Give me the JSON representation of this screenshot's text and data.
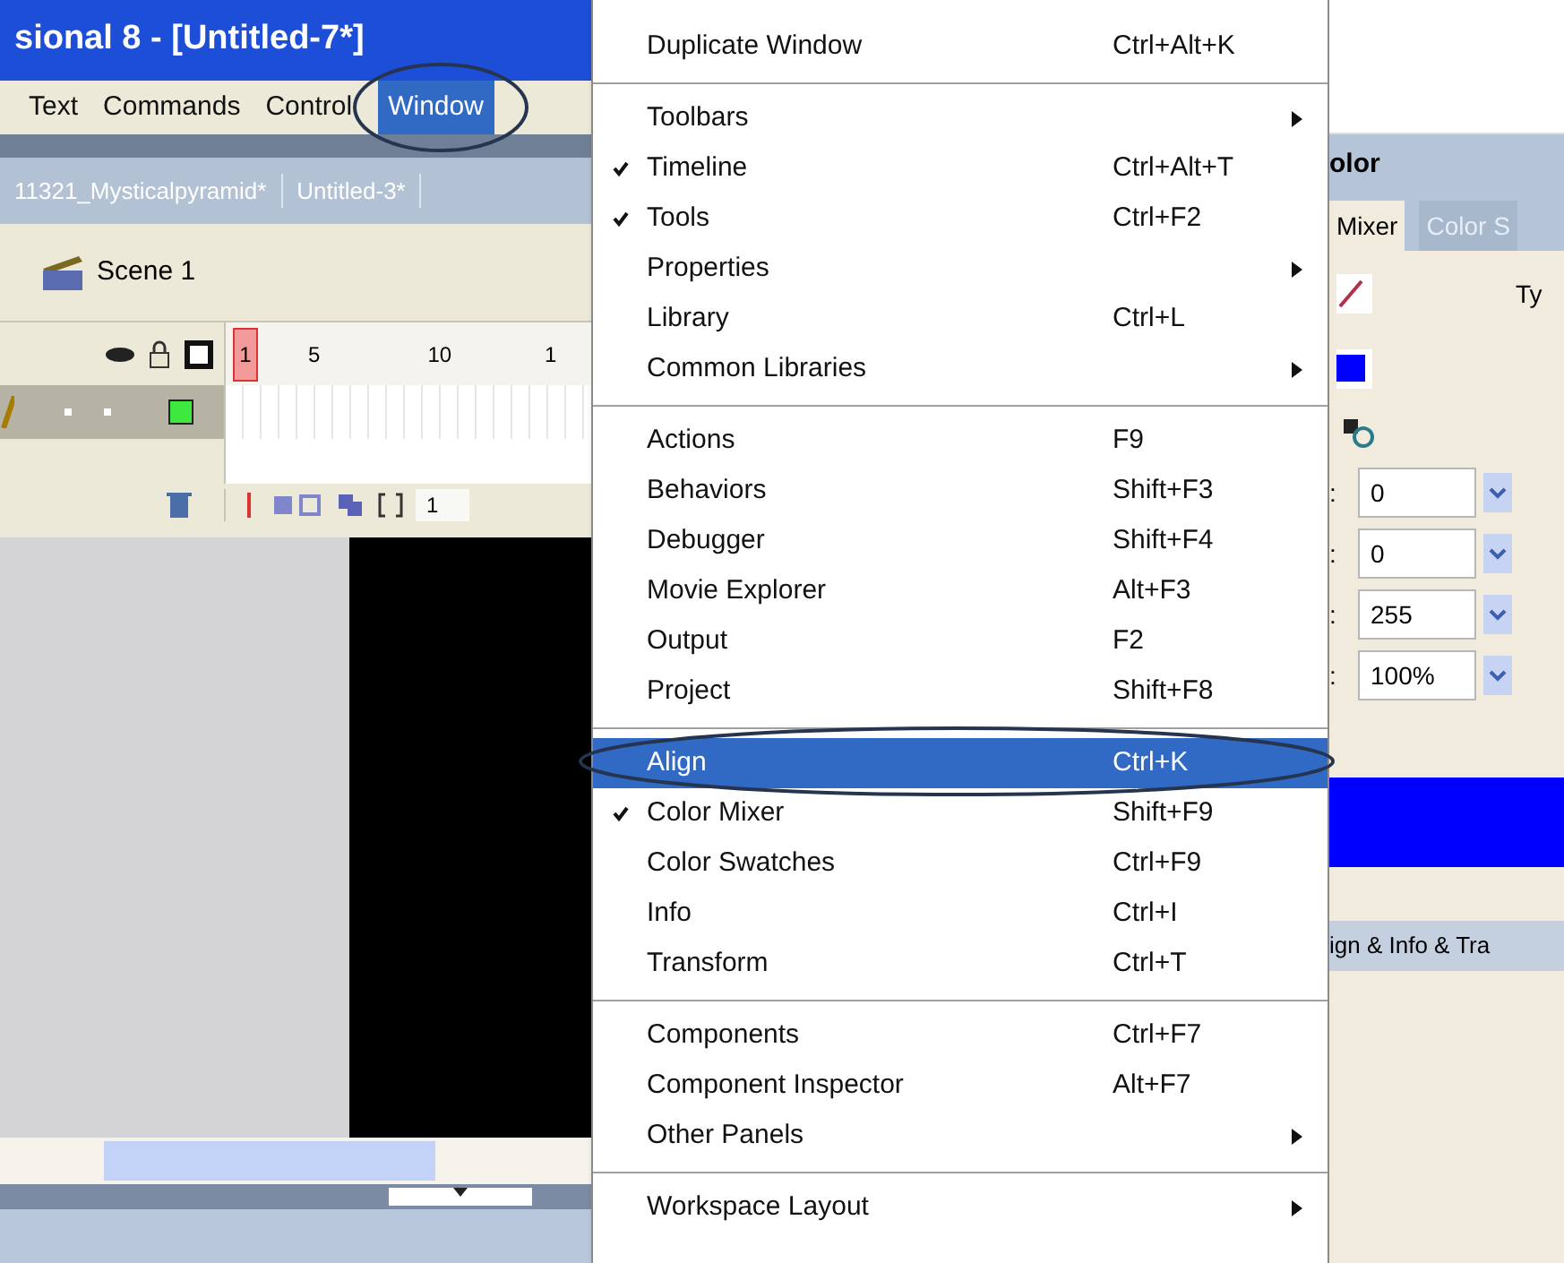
{
  "title_bar": {
    "title": "sional 8 - [Untitled-7*]"
  },
  "menu_bar": [
    {
      "label": "Text",
      "selected": false
    },
    {
      "label": "Commands",
      "selected": false
    },
    {
      "label": "Control",
      "selected": false
    },
    {
      "label": "Window",
      "selected": true
    }
  ],
  "document_tabs": [
    {
      "label": "11321_Mysticalpyramid*",
      "selected": false
    },
    {
      "label": "Untitled-3*",
      "selected": false
    }
  ],
  "scene": {
    "label": "Scene 1"
  },
  "timeline": {
    "frame_numbers": [
      "5",
      "10",
      "1"
    ],
    "playhead": "1",
    "frame_field": "1"
  },
  "window_menu": [
    {
      "kind": "item",
      "label": "Duplicate Window",
      "shortcut": "Ctrl+Alt+K",
      "checked": false,
      "submenu": false,
      "selected": false
    },
    {
      "kind": "separator"
    },
    {
      "kind": "item",
      "label": "Toolbars",
      "checked": false,
      "submenu": true,
      "selected": false
    },
    {
      "kind": "item",
      "label": "Timeline",
      "shortcut": "Ctrl+Alt+T",
      "checked": true,
      "submenu": false,
      "selected": false
    },
    {
      "kind": "item",
      "label": "Tools",
      "shortcut": "Ctrl+F2",
      "checked": true,
      "submenu": false,
      "selected": false
    },
    {
      "kind": "item",
      "label": "Properties",
      "checked": false,
      "submenu": true,
      "selected": false
    },
    {
      "kind": "item",
      "label": "Library",
      "shortcut": "Ctrl+L",
      "checked": false,
      "submenu": false,
      "selected": false
    },
    {
      "kind": "item",
      "label": "Common Libraries",
      "checked": false,
      "submenu": true,
      "selected": false
    },
    {
      "kind": "separator"
    },
    {
      "kind": "item",
      "label": "Actions",
      "shortcut": "F9",
      "checked": false,
      "submenu": false,
      "selected": false
    },
    {
      "kind": "item",
      "label": "Behaviors",
      "shortcut": "Shift+F3",
      "checked": false,
      "submenu": false,
      "selected": false
    },
    {
      "kind": "item",
      "label": "Debugger",
      "shortcut": "Shift+F4",
      "checked": false,
      "submenu": false,
      "selected": false
    },
    {
      "kind": "item",
      "label": "Movie Explorer",
      "shortcut": "Alt+F3",
      "checked": false,
      "submenu": false,
      "selected": false
    },
    {
      "kind": "item",
      "label": "Output",
      "shortcut": "F2",
      "checked": false,
      "submenu": false,
      "selected": false
    },
    {
      "kind": "item",
      "label": "Project",
      "shortcut": "Shift+F8",
      "checked": false,
      "submenu": false,
      "selected": false
    },
    {
      "kind": "separator"
    },
    {
      "kind": "item",
      "label": "Align",
      "shortcut": "Ctrl+K",
      "checked": false,
      "submenu": false,
      "selected": true
    },
    {
      "kind": "item",
      "label": "Color Mixer",
      "shortcut": "Shift+F9",
      "checked": true,
      "submenu": false,
      "selected": false
    },
    {
      "kind": "item",
      "label": "Color Swatches",
      "shortcut": "Ctrl+F9",
      "checked": false,
      "submenu": false,
      "selected": false
    },
    {
      "kind": "item",
      "label": "Info",
      "shortcut": "Ctrl+I",
      "checked": false,
      "submenu": false,
      "selected": false
    },
    {
      "kind": "item",
      "label": "Transform",
      "shortcut": "Ctrl+T",
      "checked": false,
      "submenu": false,
      "selected": false
    },
    {
      "kind": "separator"
    },
    {
      "kind": "item",
      "label": "Components",
      "shortcut": "Ctrl+F7",
      "checked": false,
      "submenu": false,
      "selected": false
    },
    {
      "kind": "item",
      "label": "Component Inspector",
      "shortcut": "Alt+F7",
      "checked": false,
      "submenu": false,
      "selected": false
    },
    {
      "kind": "item",
      "label": "Other Panels",
      "checked": false,
      "submenu": true,
      "selected": false
    },
    {
      "kind": "separator"
    },
    {
      "kind": "item",
      "label": "Workspace Layout",
      "checked": false,
      "submenu": true,
      "selected": false
    }
  ],
  "color_panel": {
    "title": "olor",
    "tabs": [
      {
        "label": "Mixer",
        "selected": true
      },
      {
        "label": "Color S",
        "selected": false
      }
    ],
    "type_label": "Ty",
    "fields": [
      {
        "label": ":",
        "value": "0"
      },
      {
        "label": ":",
        "value": "0"
      },
      {
        "label": ":",
        "value": "255"
      },
      {
        "label": ":",
        "value": "100%"
      }
    ]
  },
  "align_panel": {
    "title": "ign & Info & Tra"
  }
}
